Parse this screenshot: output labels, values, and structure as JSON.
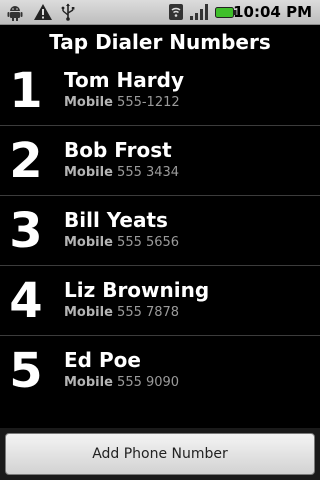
{
  "status_bar": {
    "time": "10:04 PM",
    "left_icons": [
      "android-debug-icon",
      "warning-icon",
      "usb-icon"
    ],
    "right_icons": [
      "wifi-icon",
      "signal-icon",
      "battery-icon"
    ]
  },
  "title": "Tap Dialer Numbers",
  "contacts": [
    {
      "number": "1",
      "name": "Tom Hardy",
      "phone_type": "Mobile",
      "phone": "555-1212"
    },
    {
      "number": "2",
      "name": "Bob Frost",
      "phone_type": "Mobile",
      "phone": "555 3434"
    },
    {
      "number": "3",
      "name": "Bill Yeats",
      "phone_type": "Mobile",
      "phone": "555 5656"
    },
    {
      "number": "4",
      "name": "Liz Browning",
      "phone_type": "Mobile",
      "phone": "555 7878"
    },
    {
      "number": "5",
      "name": "Ed Poe",
      "phone_type": "Mobile",
      "phone": "555 9090"
    }
  ],
  "add_button_label": "Add Phone Number",
  "colors": {
    "background": "#000000",
    "battery": "#3fbf2a",
    "divider": "#3c3c3c"
  }
}
